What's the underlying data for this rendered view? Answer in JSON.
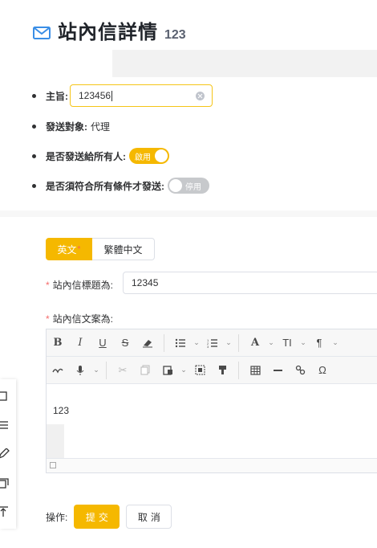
{
  "header": {
    "title": "站內信詳情",
    "id": "123"
  },
  "fields": {
    "subject_label": "主旨:",
    "subject_value": "123456",
    "target_label": "發送對象:",
    "target_value": "代理",
    "send_all_label": "是否發送給所有人:",
    "send_all_switch": {
      "text": "啟用",
      "on": true
    },
    "require_all_label": "是否須符合所有條件才發送:",
    "require_all_switch": {
      "text": "停用",
      "on": false
    }
  },
  "language_tabs": [
    {
      "label": "英文",
      "required_mark": "*",
      "active": true
    },
    {
      "label": "繁體中文",
      "active": false
    }
  ],
  "form": {
    "title_label": "站內信標題為:",
    "title_value": "12345",
    "content_label": "站內信文案為:",
    "required_mark": "*",
    "editor_content": "123"
  },
  "editor_toolbar": {
    "row1": [
      "bold-icon",
      "italic-icon",
      "underline-icon",
      "strikethrough-icon",
      "eraser-icon",
      "bullet-list-icon",
      "numbered-list-icon",
      "font-color-icon",
      "font-size-icon",
      "paragraph-icon"
    ],
    "row2": [
      "format-painter-icon",
      "microphone-icon",
      "cut-icon",
      "copy-icon",
      "paste-icon",
      "select-all-icon",
      "clean-format-icon",
      "table-icon",
      "horizontal-rule-icon",
      "link-icon",
      "omega-icon"
    ],
    "glyphs": {
      "bold": "B",
      "italic": "I",
      "underline": "U",
      "strike": "S",
      "font_color": "A",
      "font_size": "TI",
      "paragraph": "¶",
      "omega": "Ω"
    }
  },
  "actions": {
    "label": "操作:",
    "submit": "提交",
    "cancel": "取消"
  },
  "colors": {
    "accent": "#f5b800",
    "required": "#f56c6c",
    "switch_off": "#c7c9cc"
  }
}
